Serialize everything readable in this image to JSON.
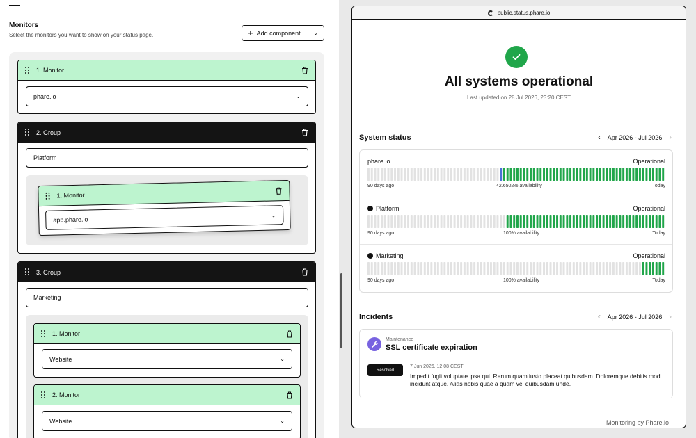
{
  "editor": {
    "title": "Monitors",
    "subtitle": "Select the monitors you want to show on your status page.",
    "add_button": "Add component",
    "items": [
      {
        "header": "1. Monitor",
        "type": "monitor",
        "value": "phare.io"
      },
      {
        "header": "2. Group",
        "type": "group",
        "name": "Platform",
        "children": [
          {
            "header": "1. Monitor",
            "value": "app.phare.io"
          }
        ]
      },
      {
        "header": "3. Group",
        "type": "group",
        "name": "Marketing",
        "children": [
          {
            "header": "1. Monitor",
            "value": "Website"
          },
          {
            "header": "2. Monitor",
            "value": "Website"
          }
        ]
      }
    ]
  },
  "preview": {
    "url": "public.status.phare.io",
    "hero_title": "All systems operational",
    "last_updated": "Last updated on 28 Jul 2026, 23:20 CEST",
    "system_status_title": "System status",
    "date_range": "Apr 2026 - Jul 2026",
    "rows": [
      {
        "name": "phare.io",
        "status": "Operational",
        "start": "90 days ago",
        "availability": "42.6502% availability",
        "end": "Today",
        "gray": 40,
        "blue": 1,
        "green": 49,
        "group": false
      },
      {
        "name": "Platform",
        "status": "Operational",
        "start": "90 days ago",
        "availability": "100% availability",
        "end": "Today",
        "gray": 42,
        "blue": 0,
        "green": 48,
        "group": true
      },
      {
        "name": "Marketing",
        "status": "Operational",
        "start": "90 days ago",
        "availability": "100% availability",
        "end": "Today",
        "gray": 83,
        "blue": 0,
        "green": 7,
        "group": true
      }
    ],
    "incidents_title": "Incidents",
    "incident": {
      "kind": "Maintenance",
      "title": "SSL certificate expiration",
      "badge": "Resolved",
      "date": "7 Jun 2026, 12:08 CEST",
      "body": "Impedit fugit voluptate ipsa qui. Rerum quam iusto placeat quibusdam. Doloremque debitis modi incidunt atque. Alias nobis quae a quam vel quibusdam unde."
    },
    "footer": "Monitoring by Phare.io"
  },
  "colors": {
    "green": "#20a64a",
    "blue": "#4a6fd6",
    "gray": "#e2e2e2",
    "monitor_header": "#bdf4cf",
    "group_header": "#141414",
    "incident_icon": "#7863e0"
  }
}
